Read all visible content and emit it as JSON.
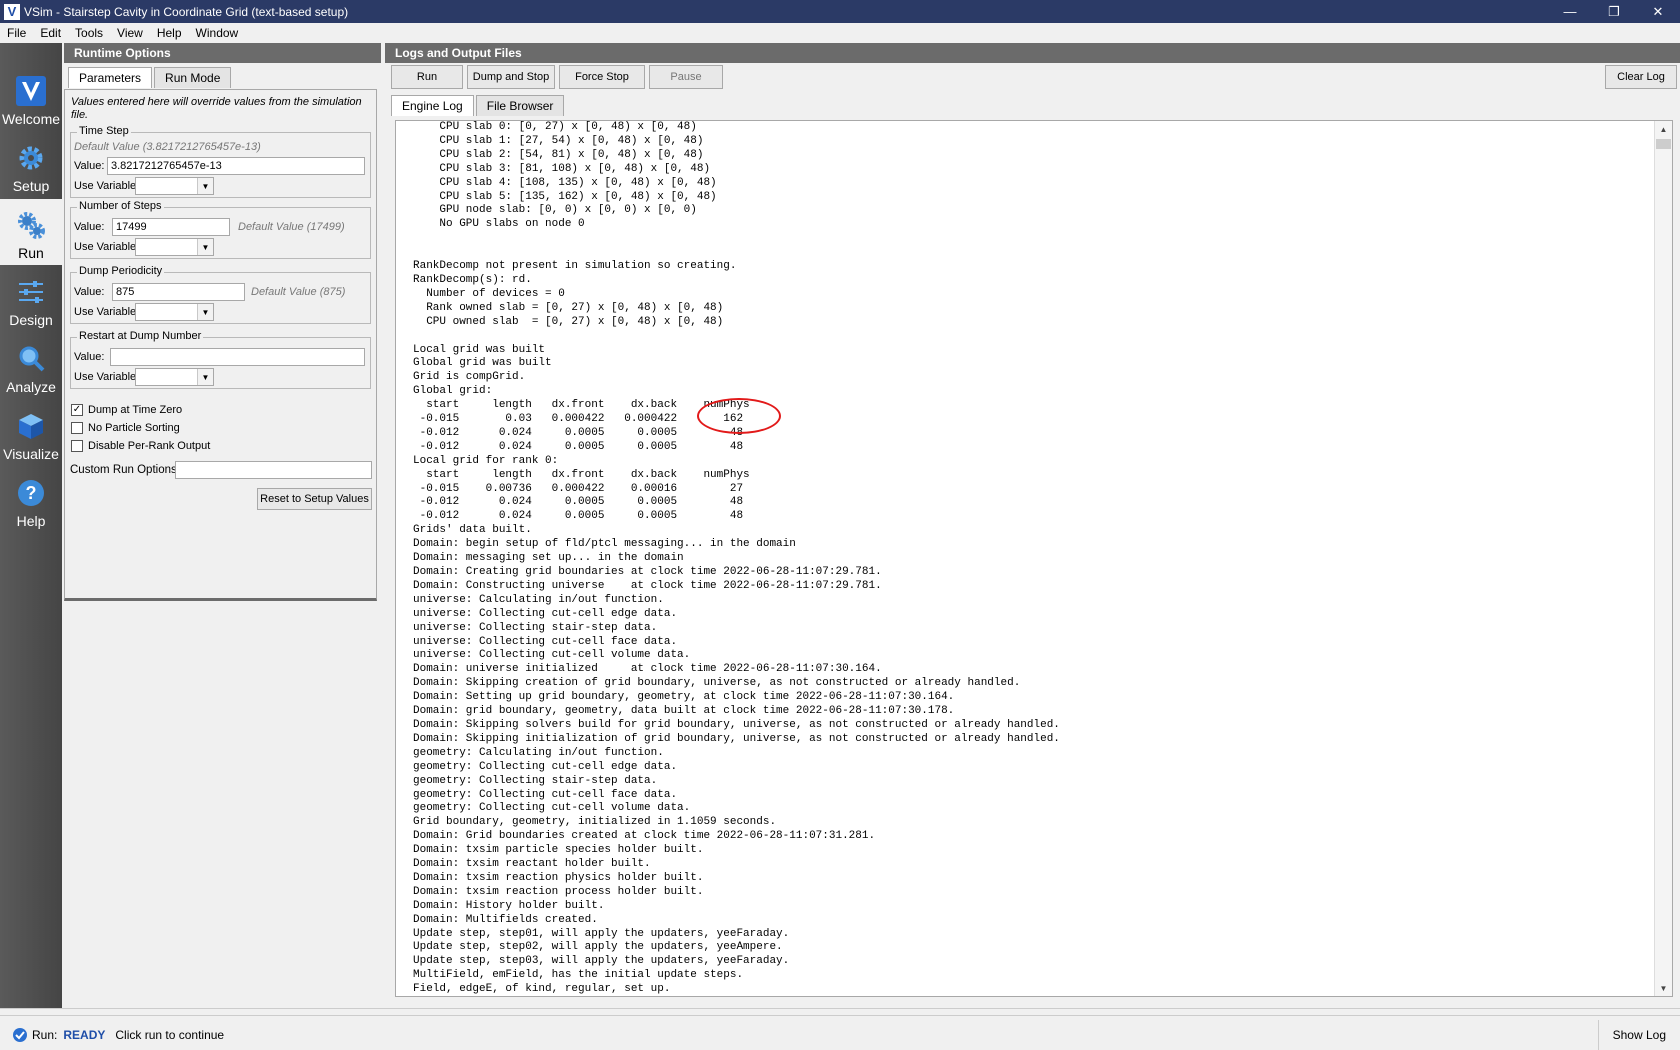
{
  "window": {
    "title": "VSim - Stairstep Cavity in Coordinate Grid (text-based setup)"
  },
  "menu": [
    "File",
    "Edit",
    "Tools",
    "View",
    "Help",
    "Window"
  ],
  "nav": {
    "items": [
      {
        "label": "Welcome"
      },
      {
        "label": "Setup"
      },
      {
        "label": "Run"
      },
      {
        "label": "Design"
      },
      {
        "label": "Analyze"
      },
      {
        "label": "Visualize"
      },
      {
        "label": "Help"
      }
    ]
  },
  "runtime": {
    "header": "Runtime Options",
    "tabs": [
      "Parameters",
      "Run Mode"
    ],
    "note": "Values entered here will override values from the simulation file.",
    "time_step": {
      "title": "Time Step",
      "default_text": "Default Value (3.8217212765457e-13)",
      "value_label": "Value:",
      "value": "3.8217212765457e-13",
      "use_var_label": "Use Variable:"
    },
    "num_steps": {
      "title": "Number of Steps",
      "value_label": "Value:",
      "value": "17499",
      "default_text": "Default Value (17499)",
      "use_var_label": "Use Variable:"
    },
    "dump_period": {
      "title": "Dump Periodicity",
      "value_label": "Value:",
      "value": "875",
      "default_text": "Default Value (875)",
      "use_var_label": "Use Variable:"
    },
    "restart": {
      "title": "Restart at Dump Number",
      "value_label": "Value:",
      "value": "",
      "use_var_label": "Use Variable:"
    },
    "checkboxes": [
      {
        "label": "Dump at Time Zero",
        "checked": true
      },
      {
        "label": "No Particle Sorting",
        "checked": false
      },
      {
        "label": "Disable Per-Rank Output",
        "checked": false
      }
    ],
    "custom_label": "Custom Run Options",
    "custom_value": "",
    "reset_button": "Reset to Setup Values"
  },
  "logs": {
    "header": "Logs and Output Files",
    "buttons": {
      "run": "Run",
      "dump_stop": "Dump and Stop",
      "force_stop": "Force Stop",
      "pause": "Pause",
      "clear": "Clear Log"
    },
    "tabs": [
      "Engine Log",
      "File Browser"
    ],
    "lines": [
      "    CPU slab 0: [0, 27) x [0, 48) x [0, 48)",
      "    CPU slab 1: [27, 54) x [0, 48) x [0, 48)",
      "    CPU slab 2: [54, 81) x [0, 48) x [0, 48)",
      "    CPU slab 3: [81, 108) x [0, 48) x [0, 48)",
      "    CPU slab 4: [108, 135) x [0, 48) x [0, 48)",
      "    CPU slab 5: [135, 162) x [0, 48) x [0, 48)",
      "    GPU node slab: [0, 0) x [0, 0) x [0, 0)",
      "    No GPU slabs on node 0",
      "",
      "",
      "RankDecomp not present in simulation so creating.",
      "RankDecomp(s): rd.",
      "  Number of devices = 0",
      "  Rank owned slab = [0, 27) x [0, 48) x [0, 48)",
      "  CPU owned slab  = [0, 27) x [0, 48) x [0, 48)",
      "",
      "Local grid was built",
      "Global grid was built",
      "Grid is compGrid.",
      "Global grid:",
      "  start     length   dx.front    dx.back    numPhys",
      " -0.015       0.03   0.000422   0.000422       162",
      " -0.012      0.024     0.0005     0.0005        48",
      " -0.012      0.024     0.0005     0.0005        48",
      "Local grid for rank 0:",
      "  start     length   dx.front    dx.back    numPhys",
      " -0.015    0.00736   0.000422    0.00016        27",
      " -0.012      0.024     0.0005     0.0005        48",
      " -0.012      0.024     0.0005     0.0005        48",
      "Grids' data built.",
      "Domain: begin setup of fld/ptcl messaging... in the domain",
      "Domain: messaging set up... in the domain",
      "Domain: Creating grid boundaries at clock time 2022-06-28-11:07:29.781.",
      "Domain: Constructing universe    at clock time 2022-06-28-11:07:29.781.",
      "universe: Calculating in/out function.",
      "universe: Collecting cut-cell edge data.",
      "universe: Collecting stair-step data.",
      "universe: Collecting cut-cell face data.",
      "universe: Collecting cut-cell volume data.",
      "Domain: universe initialized     at clock time 2022-06-28-11:07:30.164.",
      "Domain: Skipping creation of grid boundary, universe, as not constructed or already handled.",
      "Domain: Setting up grid boundary, geometry, at clock time 2022-06-28-11:07:30.164.",
      "Domain: grid boundary, geometry, data built at clock time 2022-06-28-11:07:30.178.",
      "Domain: Skipping solvers build for grid boundary, universe, as not constructed or already handled.",
      "Domain: Skipping initialization of grid boundary, universe, as not constructed or already handled.",
      "geometry: Calculating in/out function.",
      "geometry: Collecting cut-cell edge data.",
      "geometry: Collecting stair-step data.",
      "geometry: Collecting cut-cell face data.",
      "geometry: Collecting cut-cell volume data.",
      "Grid boundary, geometry, initialized in 1.1059 seconds.",
      "Domain: Grid boundaries created at clock time 2022-06-28-11:07:31.281.",
      "Domain: txsim particle species holder built.",
      "Domain: txsim reactant holder built.",
      "Domain: txsim reaction physics holder built.",
      "Domain: txsim reaction process holder built.",
      "Domain: History holder built.",
      "Domain: Multifields created.",
      "Update step, step01, will apply the updaters, yeeFaraday.",
      "Update step, step02, will apply the updaters, yeeAmpere.",
      "Update step, step03, will apply the updaters, yeeFaraday.",
      "MultiField, emField, has the initial update steps.",
      "Field, edgeE, of kind, regular, set up."
    ]
  },
  "status": {
    "label": "Run:",
    "state": "READY",
    "message": "Click run to continue",
    "show_log": "Show Log"
  }
}
